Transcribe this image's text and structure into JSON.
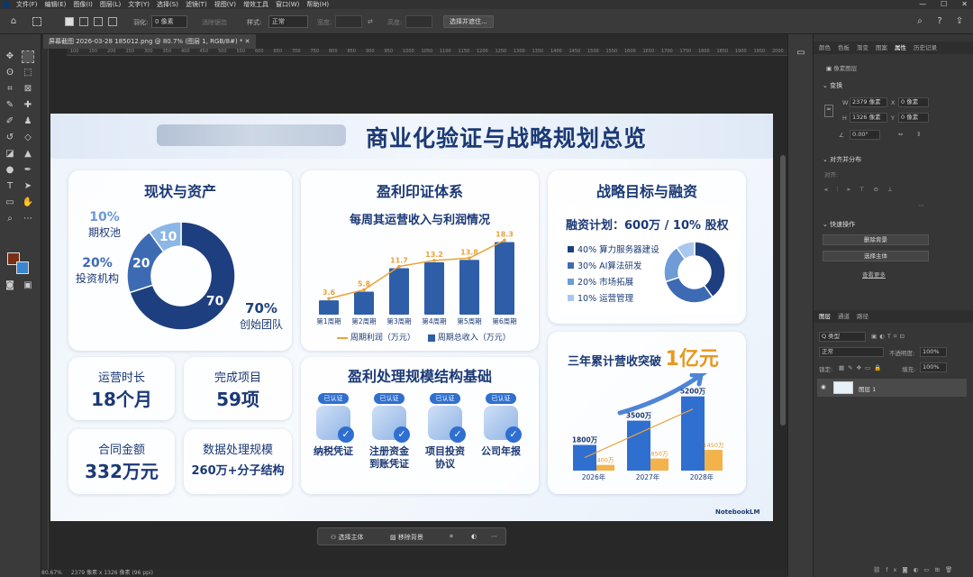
{
  "menubar": {
    "items": [
      "文件(F)",
      "编辑(E)",
      "图像(I)",
      "图层(L)",
      "文字(Y)",
      "选择(S)",
      "滤镜(T)",
      "视图(V)",
      "增效工具",
      "窗口(W)",
      "帮助(H)"
    ]
  },
  "options": {
    "feather_label": "羽化:",
    "feather_value": "0 像素",
    "antialias_label": "消除锯齿",
    "style_label": "样式:",
    "style_value": "正常",
    "width_label": "宽度:",
    "height_label": "高度:",
    "select_mask_btn": "选择并遮住..."
  },
  "doc_tab": {
    "title": "屏幕截图 2026-03-28 185012.png @ 80.7% (图层 1, RGB/8#) *"
  },
  "ruler": {
    "ticks": [
      "100",
      "150",
      "200",
      "250",
      "300",
      "350",
      "400",
      "450",
      "500",
      "550",
      "600",
      "650",
      "700",
      "750",
      "800",
      "850",
      "900",
      "950",
      "1000",
      "1050",
      "1100",
      "1150",
      "1200",
      "1250",
      "1300",
      "1350",
      "1400",
      "1450",
      "1500",
      "1550",
      "1600",
      "1650",
      "1700",
      "1750",
      "1800",
      "1850",
      "1900",
      "1950",
      "2000"
    ]
  },
  "status": {
    "zoom": "80.67%",
    "size": "2379 像素 x 1326 像素 (96 ppi)"
  },
  "context_bar": {
    "select_subject": "选择主体",
    "remove_bg": "移除背景"
  },
  "right_panel": {
    "tabs_top": [
      "颜色",
      "色板",
      "渐变",
      "图案",
      "属性",
      "历史记录"
    ],
    "active_top": "属性",
    "pixel_layer": "像素图层",
    "transform": "变换",
    "w_label": "W",
    "w_value": "2379 像素",
    "h_label": "H",
    "h_value": "1326 像素",
    "x_label": "X",
    "x_value": "0 像素",
    "y_label": "Y",
    "y_value": "0 像素",
    "angle_value": "0.00°",
    "align_title": "对齐并分布",
    "align_sub": "对齐:",
    "quick_title": "快速操作",
    "remove_bg_btn": "删除背景",
    "select_subject_btn": "选择主体",
    "more_link": "查看更多",
    "tabs_bottom": [
      "图层",
      "通道",
      "路径"
    ],
    "kind_value": "Q 类型",
    "blend_value": "正常",
    "opacity_label": "不透明度:",
    "opacity_value": "100%",
    "lock_label": "锁定:",
    "fill_label": "填充:",
    "fill_value": "100%",
    "layer_name": "图层 1"
  },
  "slide": {
    "title": "商业化验证与战略规划总览",
    "brand": "NotebookLM",
    "status_card": {
      "title": "现状与资产",
      "legend": [
        {
          "pct": "10%",
          "label": "期权池"
        },
        {
          "pct": "20%",
          "label": "投资机构"
        },
        {
          "pct": "70%",
          "label": "创始团队"
        }
      ]
    },
    "stats": [
      {
        "label": "运营时长",
        "value": "18个月"
      },
      {
        "label": "完成项目",
        "value": "59项"
      },
      {
        "label": "合同金额",
        "value": "332万元"
      },
      {
        "label": "数据处理规模",
        "value": "260万+分子结构"
      }
    ],
    "profit_card": {
      "title": "盈利印证体系",
      "chart_title": "每周其运营收入与利润情况",
      "legend_line": "周期利润（万元）",
      "legend_bar": "周期总收入（万元）"
    },
    "scale_card": {
      "title": "盈利处理规模结构基础",
      "badge": "已认证",
      "items": [
        {
          "label": "纳税凭证"
        },
        {
          "label": "注册资金\n到账凭证"
        },
        {
          "label": "项目投资\n协议"
        },
        {
          "label": "公司年报"
        }
      ]
    },
    "strategy_card": {
      "title": "战略目标与融资",
      "subtitle": "融资计划：600万 / 10% 股权",
      "legend": [
        "40% 算力服务器建设",
        "30% AI算法研发",
        "20% 市场拓展",
        "10% 运营管理"
      ]
    },
    "growth_card": {
      "title_pre": "三年累计营收突破",
      "title_big": "1亿元"
    }
  },
  "chart_data": [
    {
      "type": "pie",
      "title": "现状与资产",
      "categories": [
        "创始团队",
        "投资机构",
        "期权池"
      ],
      "values": [
        70,
        20,
        10
      ],
      "colors": [
        "#1e3f7f",
        "#3d6bb3",
        "#8bb6e6"
      ]
    },
    {
      "type": "bar",
      "title": "每周其运营收入与利润情况",
      "categories": [
        "第1周期",
        "第2周期",
        "第3周期",
        "第4周期",
        "第5周期",
        "第6周期"
      ],
      "series": [
        {
          "name": "周期总收入（万元）",
          "type": "bar",
          "values": [
            3.6,
            5.8,
            11.7,
            13.2,
            13.8,
            18.3
          ],
          "color": "#2f5ea8"
        },
        {
          "name": "周期利润（万元）",
          "type": "line",
          "values": [
            3.6,
            5.8,
            11.7,
            13.2,
            13.8,
            18.3
          ],
          "color": "#e8a33a"
        }
      ],
      "data_labels": [
        "3.6",
        "5.8",
        "11.7",
        "13.2",
        "13.8",
        "18.3"
      ],
      "ylim": [
        0,
        20
      ]
    },
    {
      "type": "pie",
      "title": "融资计划：600万 / 10% 股权",
      "categories": [
        "算力服务器建设",
        "AI算法研发",
        "市场拓展",
        "运营管理"
      ],
      "values": [
        40,
        30,
        20,
        10
      ],
      "colors": [
        "#1e3f7f",
        "#3d6bb3",
        "#6f9bd6",
        "#a9c8ee"
      ]
    },
    {
      "type": "bar",
      "title": "三年累计营收突破1亿元",
      "categories": [
        "2026年",
        "2027年",
        "2028年"
      ],
      "series": [
        {
          "name": "",
          "values": [
            1800,
            3500,
            5200
          ],
          "labels": [
            "1800万",
            "3500万",
            "5200万"
          ],
          "color": "#2f6fd0"
        },
        {
          "name": "",
          "values": [
            400,
            850,
            1450
          ],
          "labels": [
            "400万",
            "850万",
            "1450万"
          ],
          "color": "#f3b24a"
        }
      ],
      "ylim": [
        0,
        6000
      ]
    }
  ]
}
